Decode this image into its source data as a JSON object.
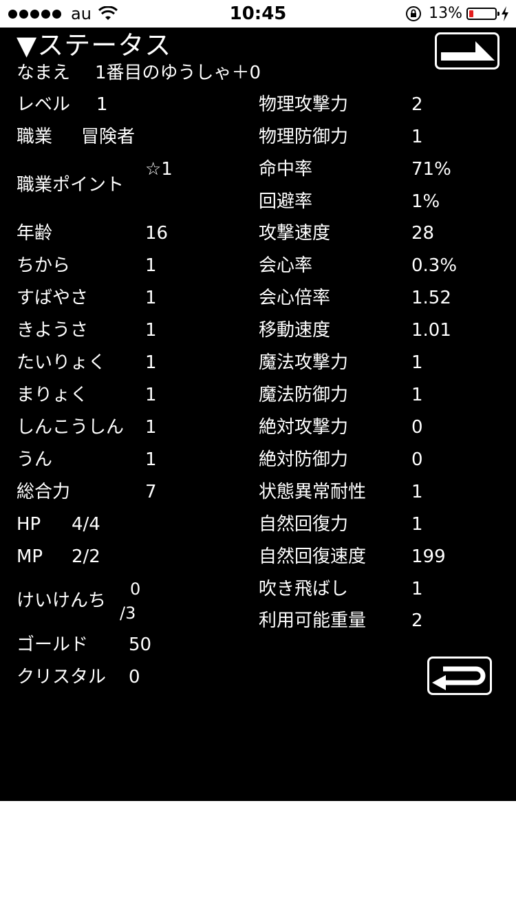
{
  "statusbar": {
    "carrier": "au",
    "time": "10:45",
    "battery": "13%"
  },
  "screen": {
    "title": "▼ステータス",
    "name_label": "なまえ",
    "name_value": "1番目のゆうしゃ＋0"
  },
  "left": {
    "level": {
      "label": "レベル",
      "value": "1"
    },
    "job": {
      "label": "職業",
      "value": "冒険者"
    },
    "job_points": {
      "label": "職業ポイント",
      "value": "☆1"
    },
    "age": {
      "label": "年齢",
      "value": "16"
    },
    "power": {
      "label": "ちから",
      "value": "1"
    },
    "agility": {
      "label": "すばやさ",
      "value": "1"
    },
    "dexterity": {
      "label": "きようさ",
      "value": "1"
    },
    "stamina": {
      "label": "たいりょく",
      "value": "1"
    },
    "magic": {
      "label": "まりょく",
      "value": "1"
    },
    "faith": {
      "label": "しんこうしん",
      "value": "1"
    },
    "luck": {
      "label": "うん",
      "value": "1"
    },
    "total": {
      "label": "総合力",
      "value": "7"
    },
    "hp": {
      "label": "HP",
      "value": "4/4"
    },
    "mp": {
      "label": "MP",
      "value": "2/2"
    },
    "exp": {
      "label": "けいけんち",
      "value_top": "0",
      "value_bottom": "/3"
    },
    "gold": {
      "label": "ゴールド",
      "value": "50"
    },
    "crystal": {
      "label": "クリスタル",
      "value": "0"
    }
  },
  "right": {
    "phys_atk": {
      "label": "物理攻撃力",
      "value": "2"
    },
    "phys_def": {
      "label": "物理防御力",
      "value": "1"
    },
    "hit_rate": {
      "label": "命中率",
      "value": "71%"
    },
    "evasion": {
      "label": "回避率",
      "value": "1%"
    },
    "atk_speed": {
      "label": "攻撃速度",
      "value": "28"
    },
    "crit_rate": {
      "label": "会心率",
      "value": "0.3%"
    },
    "crit_mult": {
      "label": "会心倍率",
      "value": "1.52"
    },
    "move_speed": {
      "label": "移動速度",
      "value": "1.01"
    },
    "mag_atk": {
      "label": "魔法攻撃力",
      "value": "1"
    },
    "mag_def": {
      "label": "魔法防御力",
      "value": "1"
    },
    "abs_atk": {
      "label": "絶対攻撃力",
      "value": "0"
    },
    "abs_def": {
      "label": "絶対防御力",
      "value": "0"
    },
    "status_res": {
      "label": "状態異常耐性",
      "value": "1"
    },
    "regen": {
      "label": "自然回復力",
      "value": "1"
    },
    "regen_speed": {
      "label": "自然回復速度",
      "value": "199"
    },
    "knockback": {
      "label": "吹き飛ばし",
      "value": "1"
    },
    "carry_weight": {
      "label": "利用可能重量",
      "value": "2"
    }
  },
  "icons": {
    "top_button": "turn-arrow-icon",
    "bottom_button": "return-arrow-icon"
  }
}
